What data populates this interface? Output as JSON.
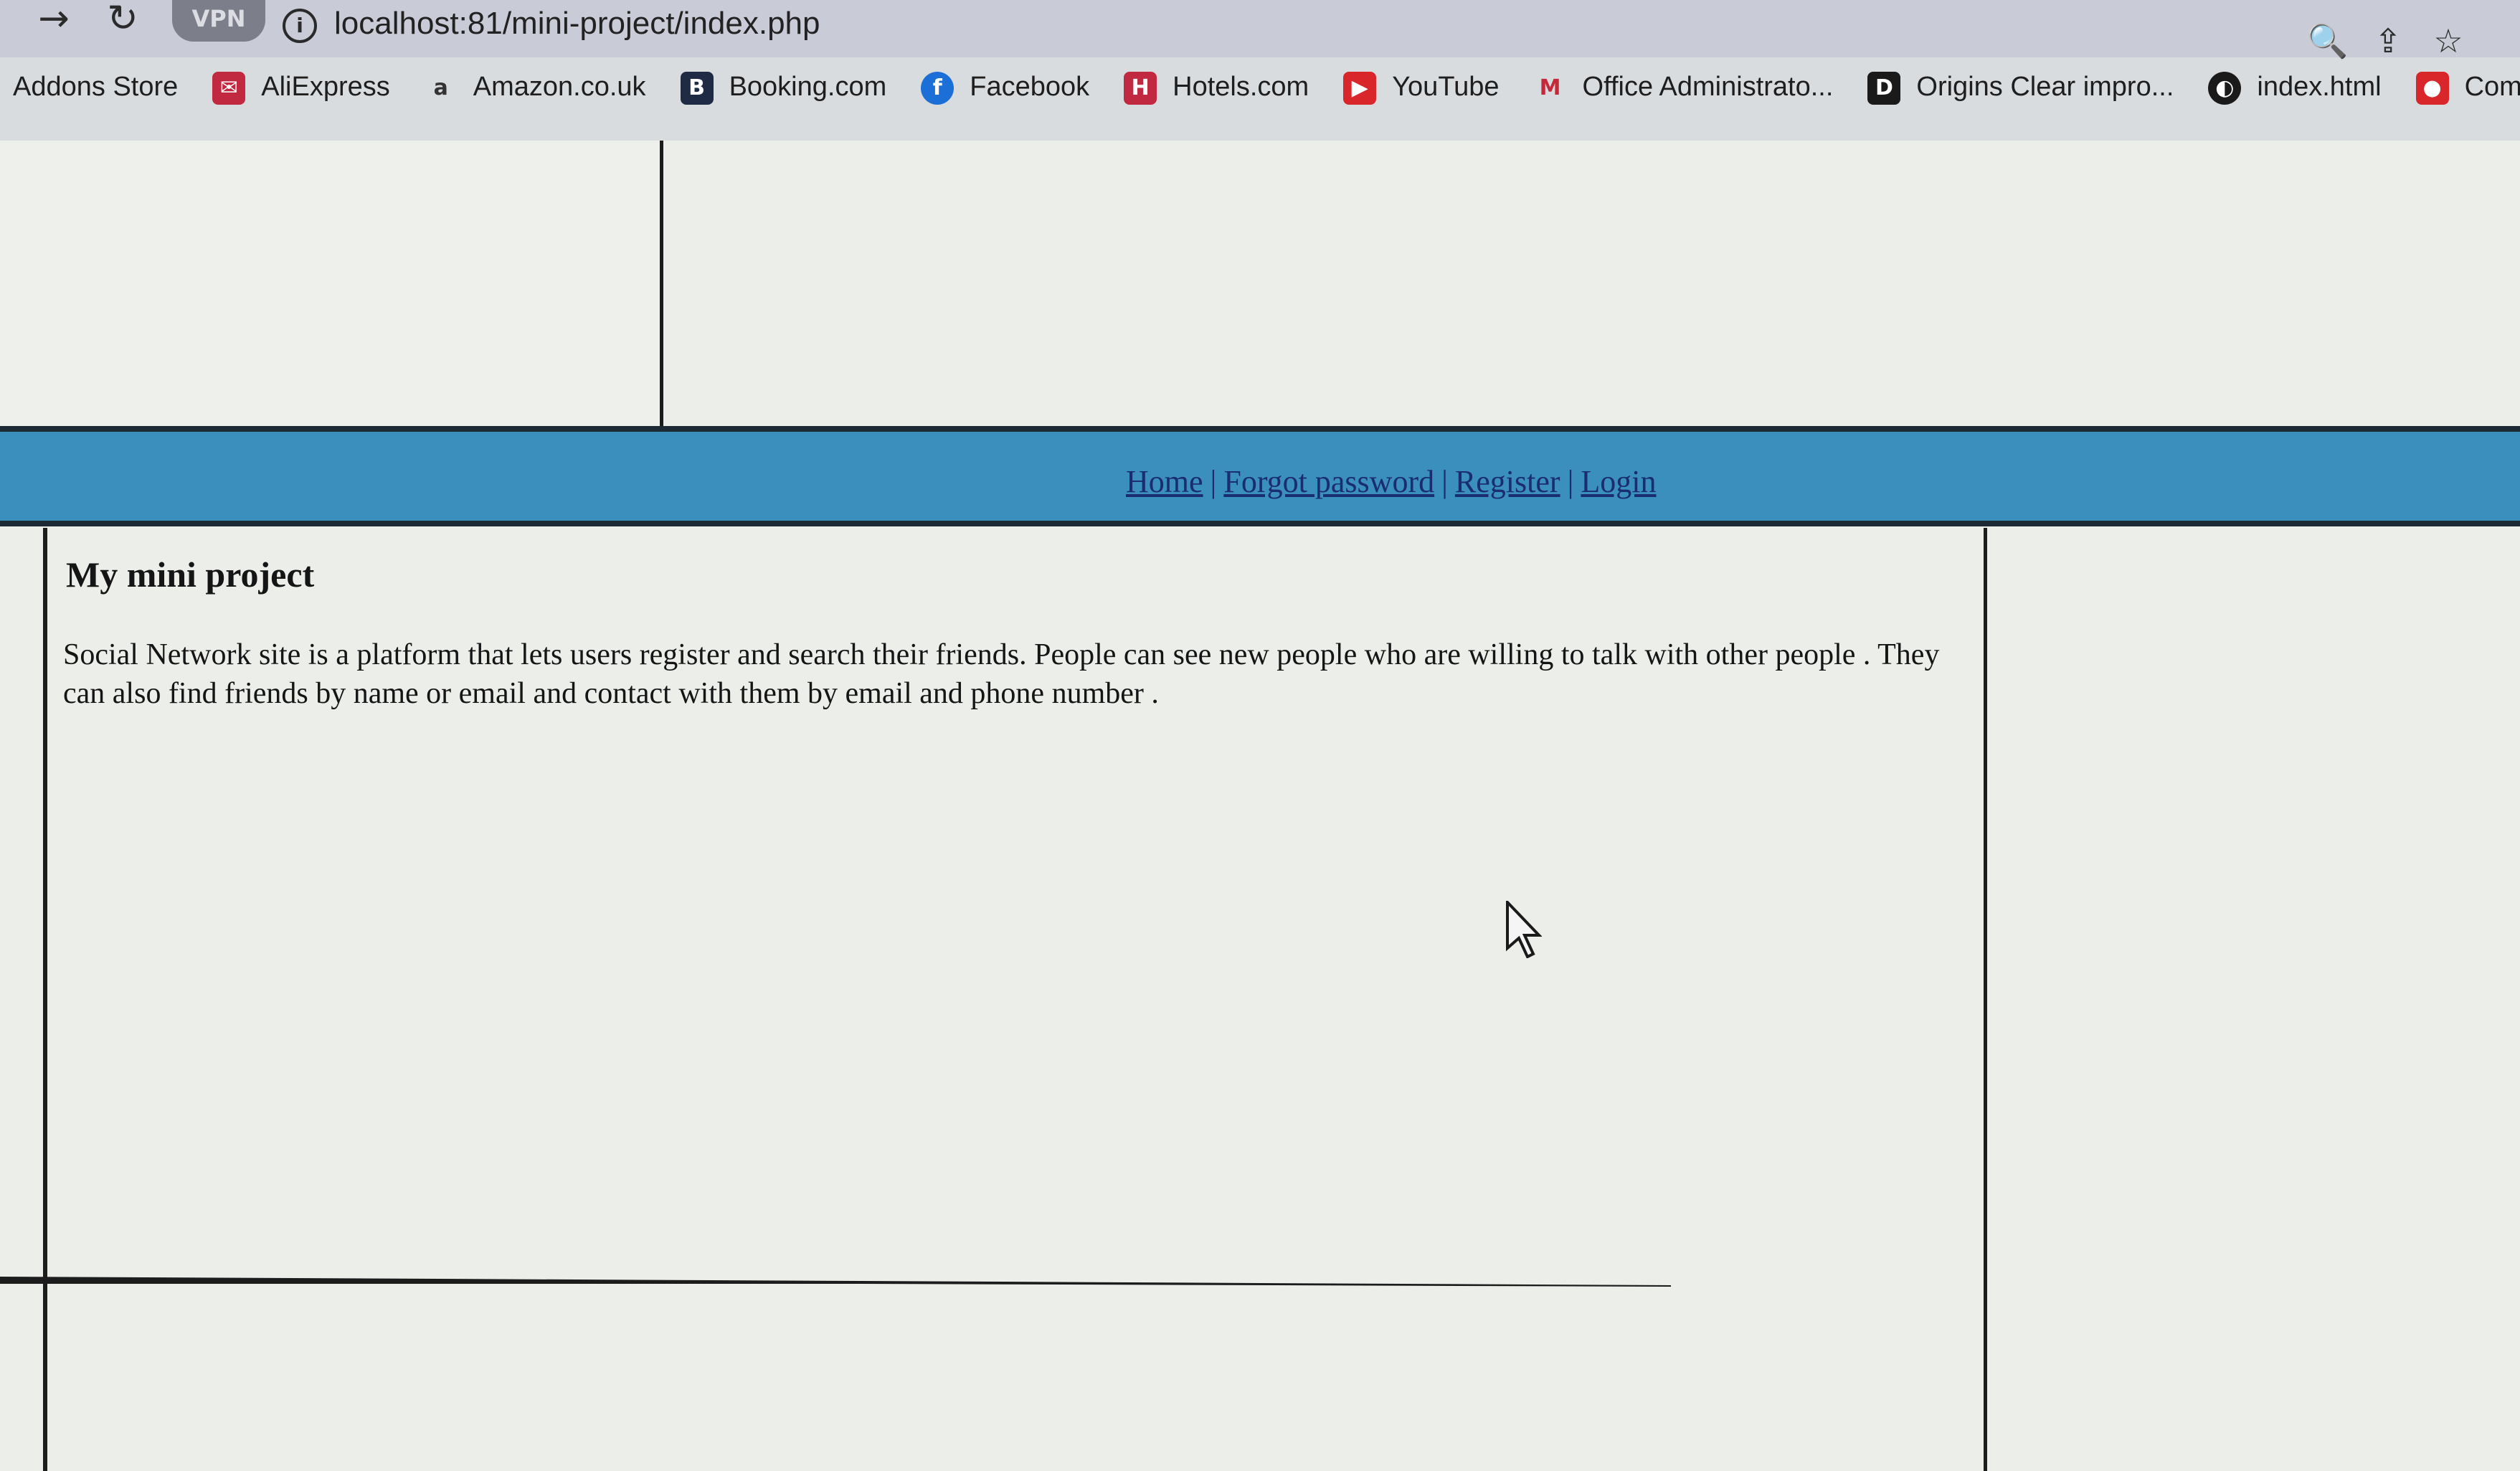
{
  "browser": {
    "url": "localhost:81/mini-project/index.php",
    "vpn_label": "VPN",
    "back_glyph": "→",
    "reload_glyph": "↻",
    "info_glyph": "i",
    "zoom_icon": "🔍",
    "share_icon": "⇪",
    "star_icon": "☆"
  },
  "bookmarks": [
    {
      "label": "Addons Store",
      "icon": "",
      "color": ""
    },
    {
      "label": "AliExpress",
      "icon": "✉",
      "color": "#c0293f"
    },
    {
      "label": "Amazon.co.uk",
      "icon": "a",
      "color": "#333333"
    },
    {
      "label": "Booking.com",
      "icon": "B",
      "color": "#1f2a44"
    },
    {
      "label": "Facebook",
      "icon": "f",
      "color": "#1c6fd6"
    },
    {
      "label": "Hotels.com",
      "icon": "H",
      "color": "#c0293f"
    },
    {
      "label": "YouTube",
      "icon": "▶",
      "color": "#d9262b"
    },
    {
      "label": "Office Administrato...",
      "icon": "M",
      "color": "#c4293a"
    },
    {
      "label": "Origins Clear impro...",
      "icon": "D",
      "color": "#1a1a1a"
    },
    {
      "label": "index.html",
      "icon": "◐",
      "color": "#1a1a1a"
    },
    {
      "label": "Comedy",
      "icon": "●",
      "color": "#d9262b"
    }
  ],
  "nav": {
    "home": "Home",
    "forgot": "Forgot password",
    "register": "Register",
    "login": "Login",
    "separator": "|"
  },
  "main": {
    "title": "My mini project",
    "description": "Social Network site is a platform that lets users register and search their friends. People can see new people who are willing to talk with other people . They can also find friends by name or email and contact with them by email and phone number ."
  },
  "colors": {
    "navbar": "#3b8fbd",
    "link": "#1a2d6e",
    "page_bg": "#eceeea"
  }
}
